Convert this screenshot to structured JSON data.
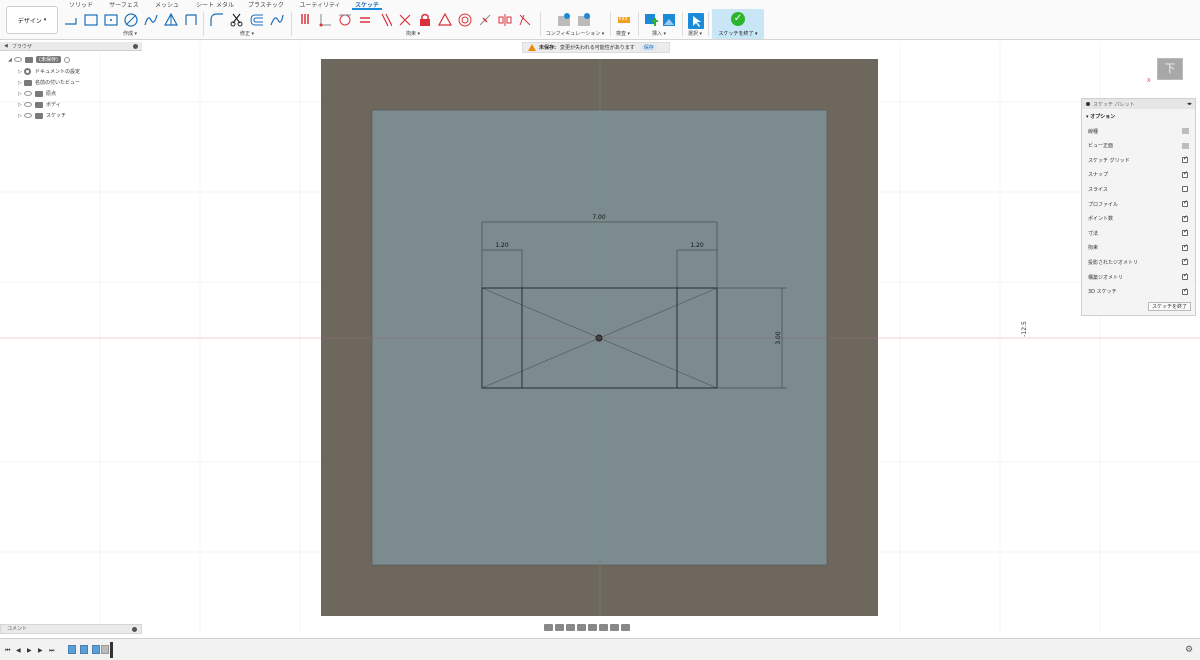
{
  "toolbar": {
    "design_label": "デザイン",
    "tabs": [
      "ソリッド",
      "サーフェス",
      "メッシュ",
      "シート メタル",
      "プラスチック",
      "ユーティリティ",
      "スケッチ"
    ],
    "groups": {
      "create": "作成",
      "modify": "修正",
      "constraints": "拘束",
      "configuration": "コンフィギュレーション",
      "inspect": "検査",
      "insert": "挿入",
      "select": "選択",
      "finish": "スケッチを終了"
    }
  },
  "browser": {
    "title": "ブラウザ",
    "root": "(未保存)",
    "items": [
      "ドキュメントの設定",
      "名前の付いたビュー",
      "原点",
      "ボディ",
      "スケッチ"
    ]
  },
  "warning": {
    "bold": "未保存:",
    "message": "変更が失われる可能性があります",
    "save": "保存"
  },
  "viewcube": {
    "face": "下",
    "axis": "X"
  },
  "sketch": {
    "dim_width": "7.00",
    "dim_left": "1.20",
    "dim_right": "1.20",
    "dim_height": "3.00",
    "coord": "-12.5"
  },
  "palette": {
    "title": "スケッチ パレット",
    "section": "オプション",
    "rows": [
      {
        "label": "線種",
        "kind": "icon"
      },
      {
        "label": "ビュー正面",
        "kind": "icon"
      },
      {
        "label": "スケッチ グリッド",
        "kind": "checked"
      },
      {
        "label": "スナップ",
        "kind": "checked"
      },
      {
        "label": "スライス",
        "kind": "unchecked"
      },
      {
        "label": "プロファイル",
        "kind": "checked"
      },
      {
        "label": "ポイント数",
        "kind": "checked"
      },
      {
        "label": "寸法",
        "kind": "checked"
      },
      {
        "label": "拘束",
        "kind": "checked"
      },
      {
        "label": "投影されたジオメトリ",
        "kind": "checked"
      },
      {
        "label": "構築ジオメトリ",
        "kind": "checked"
      },
      {
        "label": "3D スケッチ",
        "kind": "checked"
      }
    ],
    "finish_label": "スケッチを終了"
  },
  "comment": {
    "label": "コメント"
  }
}
